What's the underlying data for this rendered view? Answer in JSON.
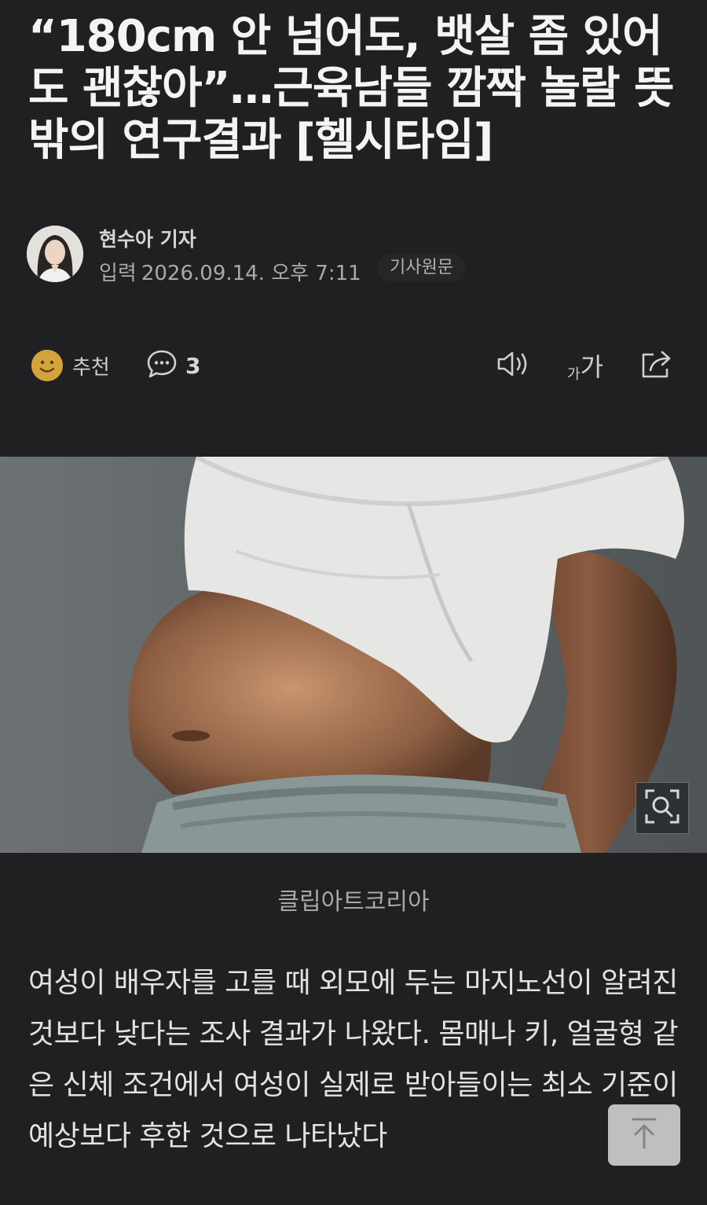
{
  "article": {
    "title": "“180cm 안 넘어도, 뱃살 좀 있어도 괜찮아”…근육남들 깜짝 놀랄 뜻밖의 연구결과 [헬시타임]",
    "author": "현수아 기자",
    "published_label": "입력",
    "published_at": "2026.09.14. 오후 7:11",
    "original_button": "기사원문"
  },
  "toolbar": {
    "recommend_label": "추천",
    "comment_count": "3",
    "font_size_small": "가",
    "font_size_large": "가"
  },
  "photo": {
    "caption": "클립아트코리아"
  },
  "body": {
    "text": "여성이 배우자를 고를 때 외모에 두는 마지노선이 알려진 것보다 낮다는 조사 결과가 나왔다. 몸매나 키, 얼굴형 같은 신체 조건에서 여성이 실제로 받아들이는 최소 기준이 예상보다 후한 것으로 나타났다"
  },
  "icons": [
    "smile-icon",
    "comment-icon",
    "speaker-icon",
    "font-size-icon",
    "share-icon",
    "zoom-icon",
    "arrow-up-icon"
  ]
}
